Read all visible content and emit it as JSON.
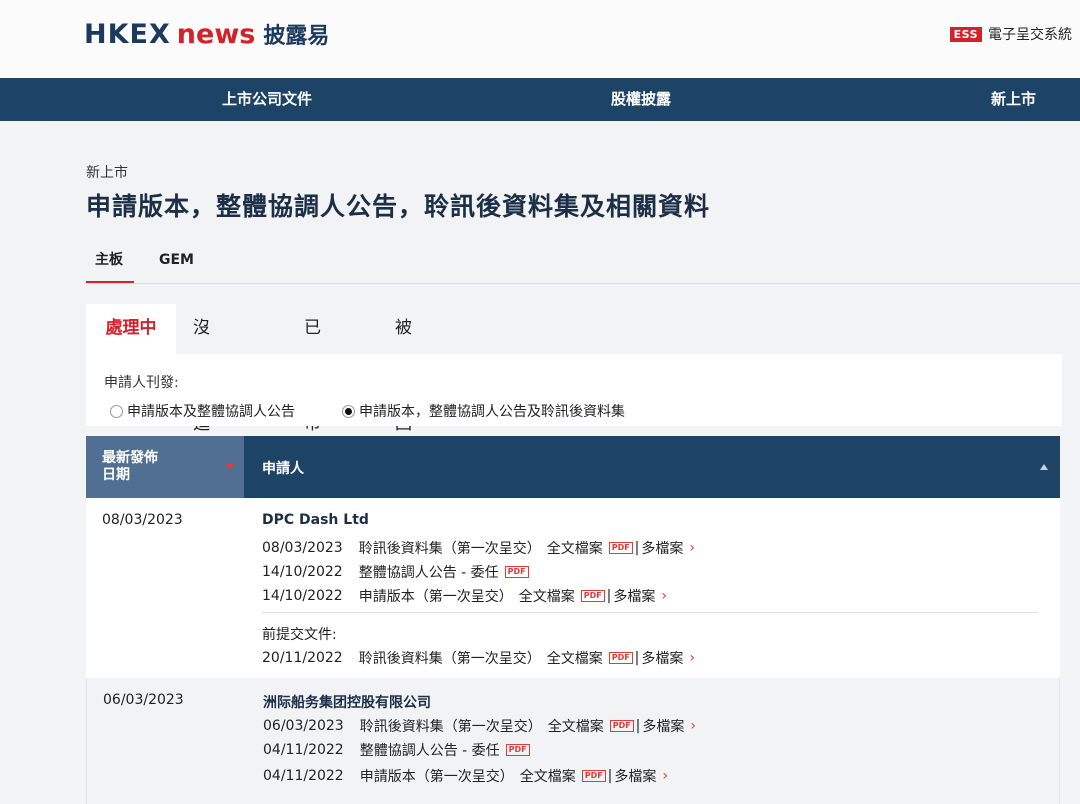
{
  "header": {
    "logo_hkex": "HKEX",
    "logo_news": "news",
    "logo_cn": "披露易",
    "ess_badge": "ESS",
    "ess_label": "電子呈交系統"
  },
  "nav": [
    "上市公司文件",
    "股權披露",
    "新上市"
  ],
  "breadcrumb": "新上市",
  "page_title": "申請版本，整體協調人公告，聆訊後資料集及相關資料",
  "board_tabs": [
    "主板",
    "GEM"
  ],
  "status_tabs": [
    "處理中",
    "沒有進展",
    "已上市",
    "被發回"
  ],
  "filter": {
    "label": "申請人刊發:",
    "options": [
      "申請版本及整體協調人公告",
      "申請版本，整體協調人公告及聆訊後資料集"
    ],
    "selected_index": 1
  },
  "table": {
    "col_date": "最新發佈\n日期",
    "col_date_line1": "最新發佈",
    "col_date_line2": "日期",
    "col_applicant": "申請人",
    "rows": [
      {
        "date": "08/03/2023",
        "applicant": "DPC Dash Ltd",
        "docs": [
          {
            "date": "08/03/2023",
            "text": "聆訊後資料集（第一次呈交）",
            "full": "全文檔案",
            "multi": "多檔案"
          },
          {
            "date": "14/10/2022",
            "text": "整體協調人公告 - 委任",
            "full": "",
            "multi": ""
          },
          {
            "date": "14/10/2022",
            "text": "申請版本（第一次呈交）",
            "full": "全文檔案",
            "multi": "多檔案"
          }
        ],
        "prev_label": "前提交文件:",
        "prev_docs": [
          {
            "date": "20/11/2022",
            "text": "聆訊後資料集（第一次呈交）",
            "full": "全文檔案",
            "multi": "多檔案"
          }
        ]
      },
      {
        "date": "06/03/2023",
        "applicant": "洲际船务集团控股有限公司",
        "docs": [
          {
            "date": "06/03/2023",
            "text": "聆訊後資料集（第一次呈交）",
            "full": "全文檔案",
            "multi": "多檔案"
          },
          {
            "date": "04/11/2022",
            "text": "整體協調人公告 - 委任",
            "full": "",
            "multi": ""
          },
          {
            "date": "04/11/2022",
            "text": "申請版本（第一次呈交）",
            "full": "全文檔案",
            "multi": "多檔案"
          }
        ]
      }
    ]
  },
  "pdf_badge": "PDF",
  "colors": {
    "brand_navy": "#1d4367",
    "accent_red": "#d2232a",
    "header_date_col": "#516f92"
  }
}
